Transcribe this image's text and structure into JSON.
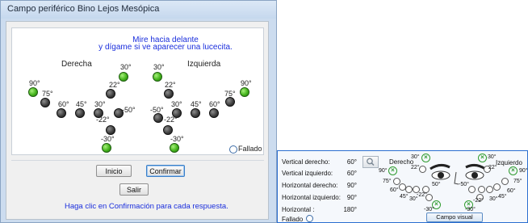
{
  "window": {
    "title": "Campo periférico Bino Lejos Mesópica"
  },
  "instructions": {
    "line1": "Mire hacia delante",
    "line2": "y dígame si ve aparecer una lucecita."
  },
  "labels": {
    "right": "Derecha",
    "left": "Izquierda"
  },
  "degree_labels": {
    "r_v30": "30°",
    "l_v30": "30°",
    "r_v22": "22°",
    "l_v22": "22°",
    "h90r": "90°",
    "h75r": "75°",
    "h60r": "60°",
    "h45r": "45°",
    "h30r": "30°",
    "h50r": "-50°",
    "h50l": "-50°",
    "h30l": "30°",
    "h45l": "45°",
    "h60l": "60°",
    "h75l": "75°",
    "h90l": "90°",
    "r_m22": "-22°",
    "l_m22": "-22°",
    "r_m30": "-30°",
    "l_m30": "-30°"
  },
  "failed_option": "Fallado",
  "buttons": {
    "start": "Inicio",
    "confirm": "Confirmar",
    "exit": "Salir"
  },
  "footer_hint": "Haga clic en Confirmación para cada respuesta.",
  "summary": {
    "rows": [
      {
        "label": "Vertical derecho:",
        "value": "60°"
      },
      {
        "label": "Vertical izquierdo:",
        "value": "60°"
      },
      {
        "label": "Horizontal derecho:",
        "value": "90°"
      },
      {
        "label": "Horizontal izquierdo:",
        "value": "90°"
      },
      {
        "label": "Horizontal :",
        "value": "180°"
      }
    ],
    "failed_label": "Fallado",
    "right_label": "Derecho",
    "left_label": "Izquierdo",
    "deg": {
      "t30r": "30°",
      "t30l": "30°",
      "t22r": "22°",
      "t22l": "22°",
      "s90r": "90°",
      "s90l": "90°",
      "s75r": "75°",
      "s75l": "75°",
      "s60r": "60°",
      "s60l": "60°",
      "s45r": "45°",
      "s45l": "45°",
      "s30r": "30°",
      "s30l": "30°",
      "s50r": "50°",
      "s50l": "-50°",
      "s22r": "-22°",
      "s22l": "-22°",
      "s_30r": "-30°",
      "s_30l": "-30°"
    },
    "button": "Campo visual"
  },
  "colors": {
    "tested_dot": "#44b41c",
    "untested_dot": "#3a3a3a",
    "instruction_text": "#1a2edc",
    "summary_border": "#2b6ed0"
  }
}
